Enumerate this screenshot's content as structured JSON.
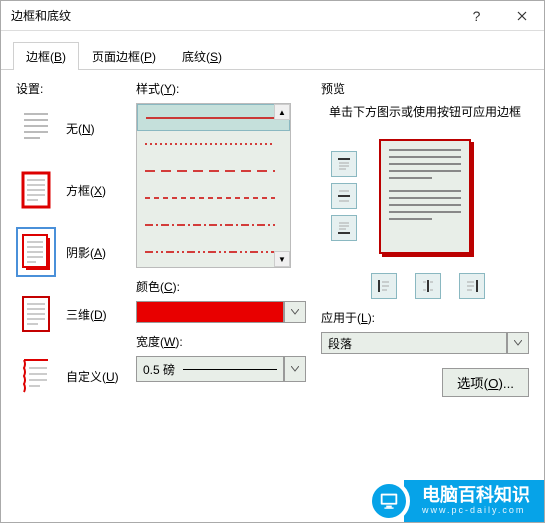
{
  "titlebar": {
    "title": "边框和底纹"
  },
  "tabs": [
    {
      "label": "边框(B)",
      "hotkey": "B"
    },
    {
      "label": "页面边框(P)",
      "hotkey": "P"
    },
    {
      "label": "底纹(S)",
      "hotkey": "S"
    }
  ],
  "sections": {
    "setting": "设置:",
    "style": "样式(Y):",
    "color": "颜色(C):",
    "width": "宽度(W):",
    "preview": "预览",
    "apply": "应用于(L):"
  },
  "settings": [
    {
      "label": "无(N)"
    },
    {
      "label": "方框(X)"
    },
    {
      "label": "阴影(A)"
    },
    {
      "label": "三维(D)"
    },
    {
      "label": "自定义(U)"
    }
  ],
  "selected_setting_index": 2,
  "color_hex": "#e80000",
  "width_value": "0.5 磅",
  "preview_hint": "单击下方图示或使用按钮可应用边框",
  "apply_value": "段落",
  "options_button": "选项(O)...",
  "watermark": {
    "main": "电脑百科知识",
    "sub": "www.pc-daily.com"
  },
  "style_items": [
    {
      "kind": "solid"
    },
    {
      "kind": "dotted"
    },
    {
      "kind": "dashed-wide"
    },
    {
      "kind": "dashed"
    },
    {
      "kind": "dashdot"
    },
    {
      "kind": "dashdotdot"
    }
  ],
  "selected_style_index": 0
}
